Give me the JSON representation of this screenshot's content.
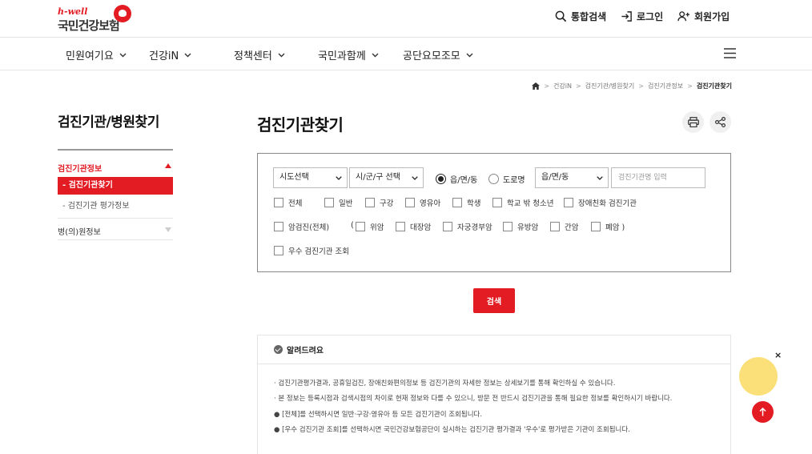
{
  "header": {
    "logo_en": "h-well",
    "logo_ko": "국민건강보험",
    "util": [
      {
        "label": "통합검색",
        "icon": "search-icon"
      },
      {
        "label": "로그인",
        "icon": "login-icon"
      },
      {
        "label": "회원가입",
        "icon": "user-plus-icon"
      }
    ]
  },
  "gnb": {
    "items": [
      {
        "label": "민원여기요"
      },
      {
        "label": "건강iN"
      },
      {
        "label": "정책센터"
      },
      {
        "label": "국민과함께"
      },
      {
        "label": "공단요모조모"
      }
    ],
    "menu_icon": "hamburger-icon"
  },
  "breadcrumb": {
    "home_icon": "home-icon",
    "items": [
      "건강iN",
      "검진기관/병원찾기",
      "검진기관정보",
      "검진기관찾기"
    ]
  },
  "lnb": {
    "title": "검진기관/병원찾기",
    "sections": [
      {
        "label": "검진기관정보",
        "expanded": true,
        "children": [
          {
            "label": "- 검진기관찾기",
            "active": true
          },
          {
            "label": "- 검진기관 평가정보",
            "active": false
          }
        ]
      },
      {
        "label": "병(의)원정보",
        "expanded": false
      }
    ]
  },
  "main": {
    "title": "검진기관찾기",
    "print_icon": "print-icon",
    "share_icon": "share-icon",
    "search": {
      "sido": "시도선택",
      "sigungu": "시/군/구 선택",
      "radio_1": "읍/면/동",
      "radio_2": "도로명",
      "radio_selected": "읍/면/동",
      "emd": "읍/면/동",
      "name_placeholder": "검진기관명 입력",
      "checks_row1": [
        "전체",
        "일반",
        "구강",
        "영유아",
        "학생",
        "학교 밖 청소년",
        "장애친화 검진기관"
      ],
      "cancer_all": "암검진(전체)",
      "paren_open": "(",
      "checks_row2": [
        "위암",
        "대장암",
        "자궁경부암",
        "유방암",
        "간암",
        "폐암 )"
      ],
      "excellent": "우수 검진기관 조회"
    },
    "search_button": "검색",
    "notice": {
      "title": "알려드려요",
      "items": [
        "· 검진기관평가결과, 공휴일검진, 장애친화편의정보 등 검진기관의 자세한 정보는 상세보기를 통해 확인하실 수 있습니다.",
        "· 본 정보는 등록시점과 검색시점의 차이로 현재 정보와 다를 수 있으니, 방문 전 반드시 검진기관을 통해 필요한 정보를 확인하시기 바랍니다.",
        "● [전체]를 선택하시면 일반·구강·영유아 등 모든 검진기관이 조회됩니다.",
        "● [우수 검진기관 조회]를 선택하시면 국민건강보험공단이 실시하는 검진기관 평가결과 '우수'로 평가받은 기관이 조회됩니다."
      ]
    }
  },
  "floating": {
    "close": "×",
    "top_icon": "arrow-up-icon"
  },
  "colors": {
    "brand_red": "#e31b23",
    "float_yellow": "#fbe07a"
  }
}
